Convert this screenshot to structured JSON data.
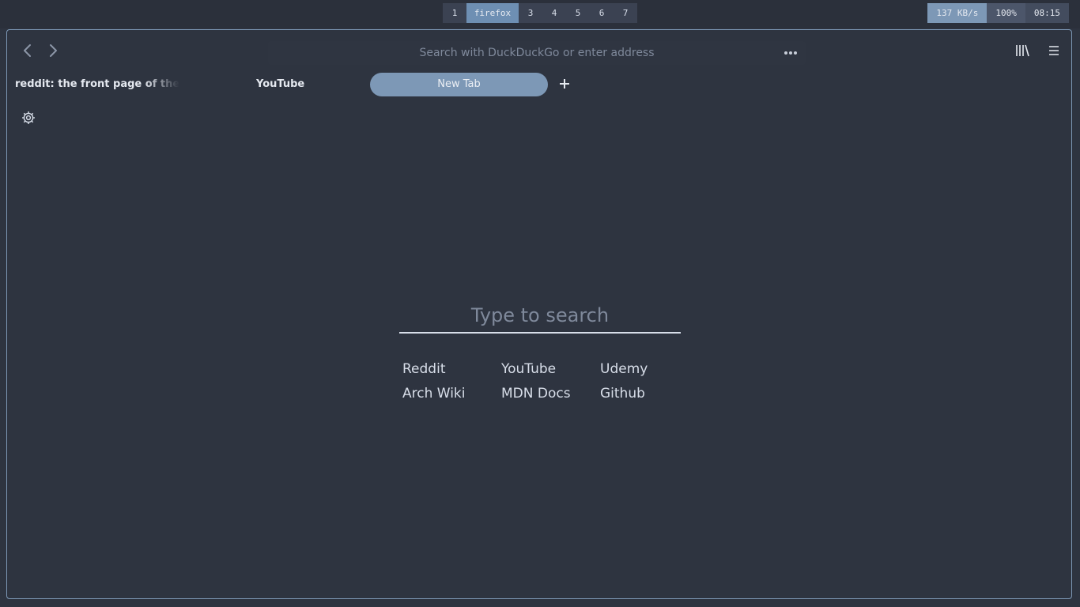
{
  "topbar": {
    "workspaces": [
      {
        "label": "1",
        "active": false
      },
      {
        "label": "firefox",
        "active": true
      },
      {
        "label": "3",
        "active": false
      },
      {
        "label": "4",
        "active": false
      },
      {
        "label": "5",
        "active": false
      },
      {
        "label": "6",
        "active": false
      },
      {
        "label": "7",
        "active": false
      }
    ],
    "network_speed": "137 KB/s",
    "battery": "100%",
    "clock": "08:15"
  },
  "browser": {
    "urlbar_placeholder": "Search with DuckDuckGo or enter address",
    "tabs": [
      {
        "label": "reddit: the front page of the internet",
        "active": false
      },
      {
        "label": "YouTube",
        "active": false
      },
      {
        "label": "New Tab",
        "active": true
      }
    ],
    "icons": {
      "back": "chevron-left-icon",
      "forward": "chevron-right-icon",
      "page_actions": "more-horizontal-icon",
      "library": "library-icon",
      "menu": "hamburger-menu-icon",
      "new_tab": "plus-icon",
      "settings": "gear-icon"
    }
  },
  "newtab": {
    "search_placeholder": "Type to search",
    "links": [
      {
        "label": "Reddit"
      },
      {
        "label": "YouTube"
      },
      {
        "label": "Udemy"
      },
      {
        "label": "Arch Wiki"
      },
      {
        "label": "MDN Docs"
      },
      {
        "label": "Github"
      }
    ]
  },
  "colors": {
    "background": "#2e3440",
    "accent": "#7d98b6",
    "text": "#d8dee9"
  }
}
